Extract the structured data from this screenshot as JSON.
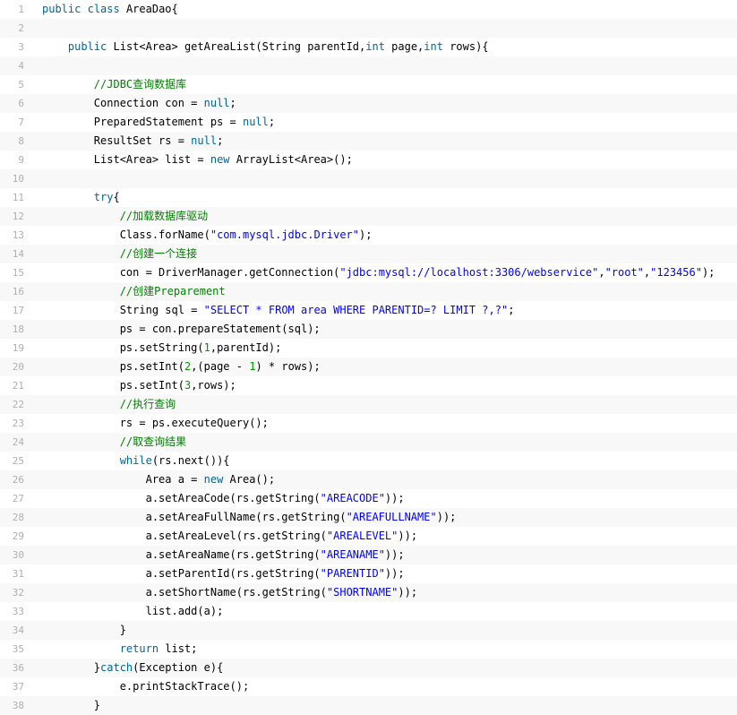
{
  "colors": {
    "gutter_border": "#6ce26c",
    "line_number": "#afafaf",
    "keyword": "#006699",
    "string": "#0000ff",
    "comment": "#008200",
    "plain": "#000000",
    "stripe": "#f8f8f8"
  },
  "lines": [
    {
      "n": "1",
      "t": [
        [
          "kw",
          "public"
        ],
        [
          "p",
          " "
        ],
        [
          "kw",
          "class"
        ],
        [
          "p",
          " AreaDao{"
        ]
      ]
    },
    {
      "n": "2",
      "t": []
    },
    {
      "n": "3",
      "t": [
        [
          "p",
          "    "
        ],
        [
          "kw",
          "public"
        ],
        [
          "p",
          " List<Area> getAreaList(String parentId,"
        ],
        [
          "kw",
          "int"
        ],
        [
          "p",
          " page,"
        ],
        [
          "kw",
          "int"
        ],
        [
          "p",
          " rows){"
        ]
      ]
    },
    {
      "n": "4",
      "t": []
    },
    {
      "n": "5",
      "t": [
        [
          "p",
          "        "
        ],
        [
          "com",
          "//JDBC查询数据库"
        ]
      ]
    },
    {
      "n": "6",
      "t": [
        [
          "p",
          "        Connection con = "
        ],
        [
          "kw",
          "null"
        ],
        [
          "p",
          ";"
        ]
      ]
    },
    {
      "n": "7",
      "t": [
        [
          "p",
          "        PreparedStatement ps = "
        ],
        [
          "kw",
          "null"
        ],
        [
          "p",
          ";"
        ]
      ]
    },
    {
      "n": "8",
      "t": [
        [
          "p",
          "        ResultSet rs = "
        ],
        [
          "kw",
          "null"
        ],
        [
          "p",
          ";"
        ]
      ]
    },
    {
      "n": "9",
      "t": [
        [
          "p",
          "        List<Area> list = "
        ],
        [
          "kw",
          "new"
        ],
        [
          "p",
          " ArrayList<Area>();"
        ]
      ]
    },
    {
      "n": "10",
      "t": []
    },
    {
      "n": "11",
      "t": [
        [
          "p",
          "        "
        ],
        [
          "kw",
          "try"
        ],
        [
          "p",
          "{"
        ]
      ]
    },
    {
      "n": "12",
      "t": [
        [
          "p",
          "            "
        ],
        [
          "com",
          "//加载数据库驱动"
        ]
      ]
    },
    {
      "n": "13",
      "t": [
        [
          "p",
          "            Class.forName("
        ],
        [
          "str",
          "\"com.mysql.jdbc.Driver\""
        ],
        [
          "p",
          ");"
        ]
      ]
    },
    {
      "n": "14",
      "t": [
        [
          "p",
          "            "
        ],
        [
          "com",
          "//创建一个连接"
        ]
      ]
    },
    {
      "n": "15",
      "t": [
        [
          "p",
          "            con = DriverManager.getConnection("
        ],
        [
          "str",
          "\"jdbc:mysql://localhost:3306/webservice\""
        ],
        [
          "p",
          ","
        ],
        [
          "str",
          "\"root\""
        ],
        [
          "p",
          ","
        ],
        [
          "str",
          "\"123456\""
        ],
        [
          "p",
          ");"
        ]
      ]
    },
    {
      "n": "16",
      "t": [
        [
          "p",
          "            "
        ],
        [
          "com",
          "//创建Preparement"
        ]
      ]
    },
    {
      "n": "17",
      "t": [
        [
          "p",
          "            String sql = "
        ],
        [
          "str",
          "\"SELECT * FROM area WHERE PARENTID=? LIMIT ?,?\""
        ],
        [
          "p",
          ";"
        ]
      ]
    },
    {
      "n": "18",
      "t": [
        [
          "p",
          "            ps = con.prepareStatement(sql);"
        ]
      ]
    },
    {
      "n": "19",
      "t": [
        [
          "p",
          "            ps.setString("
        ],
        [
          "num",
          "1"
        ],
        [
          "p",
          ",parentId);"
        ]
      ]
    },
    {
      "n": "20",
      "t": [
        [
          "p",
          "            ps.setInt("
        ],
        [
          "num",
          "2"
        ],
        [
          "p",
          ",(page - "
        ],
        [
          "num",
          "1"
        ],
        [
          "p",
          ") * rows);"
        ]
      ]
    },
    {
      "n": "21",
      "t": [
        [
          "p",
          "            ps.setInt("
        ],
        [
          "num",
          "3"
        ],
        [
          "p",
          ",rows);"
        ]
      ]
    },
    {
      "n": "22",
      "t": [
        [
          "p",
          "            "
        ],
        [
          "com",
          "//执行查询"
        ]
      ]
    },
    {
      "n": "23",
      "t": [
        [
          "p",
          "            rs = ps.executeQuery();"
        ]
      ]
    },
    {
      "n": "24",
      "t": [
        [
          "p",
          "            "
        ],
        [
          "com",
          "//取查询结果"
        ]
      ]
    },
    {
      "n": "25",
      "t": [
        [
          "p",
          "            "
        ],
        [
          "kw",
          "while"
        ],
        [
          "p",
          "(rs.next()){"
        ]
      ]
    },
    {
      "n": "26",
      "t": [
        [
          "p",
          "                Area a = "
        ],
        [
          "kw",
          "new"
        ],
        [
          "p",
          " Area();"
        ]
      ]
    },
    {
      "n": "27",
      "t": [
        [
          "p",
          "                a.setAreaCode(rs.getString("
        ],
        [
          "str",
          "\"AREACODE\""
        ],
        [
          "p",
          "));"
        ]
      ]
    },
    {
      "n": "28",
      "t": [
        [
          "p",
          "                a.setAreaFullName(rs.getString("
        ],
        [
          "str",
          "\"AREAFULLNAME\""
        ],
        [
          "p",
          "));"
        ]
      ]
    },
    {
      "n": "29",
      "t": [
        [
          "p",
          "                a.setAreaLevel(rs.getString("
        ],
        [
          "str",
          "\"AREALEVEL\""
        ],
        [
          "p",
          "));"
        ]
      ]
    },
    {
      "n": "30",
      "t": [
        [
          "p",
          "                a.setAreaName(rs.getString("
        ],
        [
          "str",
          "\"AREANAME\""
        ],
        [
          "p",
          "));"
        ]
      ]
    },
    {
      "n": "31",
      "t": [
        [
          "p",
          "                a.setParentId(rs.getString("
        ],
        [
          "str",
          "\"PARENTID\""
        ],
        [
          "p",
          "));"
        ]
      ]
    },
    {
      "n": "32",
      "t": [
        [
          "p",
          "                a.setShortName(rs.getString("
        ],
        [
          "str",
          "\"SHORTNAME\""
        ],
        [
          "p",
          "));"
        ]
      ]
    },
    {
      "n": "33",
      "t": [
        [
          "p",
          "                list.add(a);"
        ]
      ]
    },
    {
      "n": "34",
      "t": [
        [
          "p",
          "            }"
        ]
      ]
    },
    {
      "n": "35",
      "t": [
        [
          "p",
          "            "
        ],
        [
          "kw",
          "return"
        ],
        [
          "p",
          " list;"
        ]
      ]
    },
    {
      "n": "36",
      "t": [
        [
          "p",
          "        }"
        ],
        [
          "kw",
          "catch"
        ],
        [
          "p",
          "(Exception e){"
        ]
      ]
    },
    {
      "n": "37",
      "t": [
        [
          "p",
          "            e.printStackTrace();"
        ]
      ]
    },
    {
      "n": "38",
      "t": [
        [
          "p",
          "        }"
        ]
      ]
    }
  ]
}
